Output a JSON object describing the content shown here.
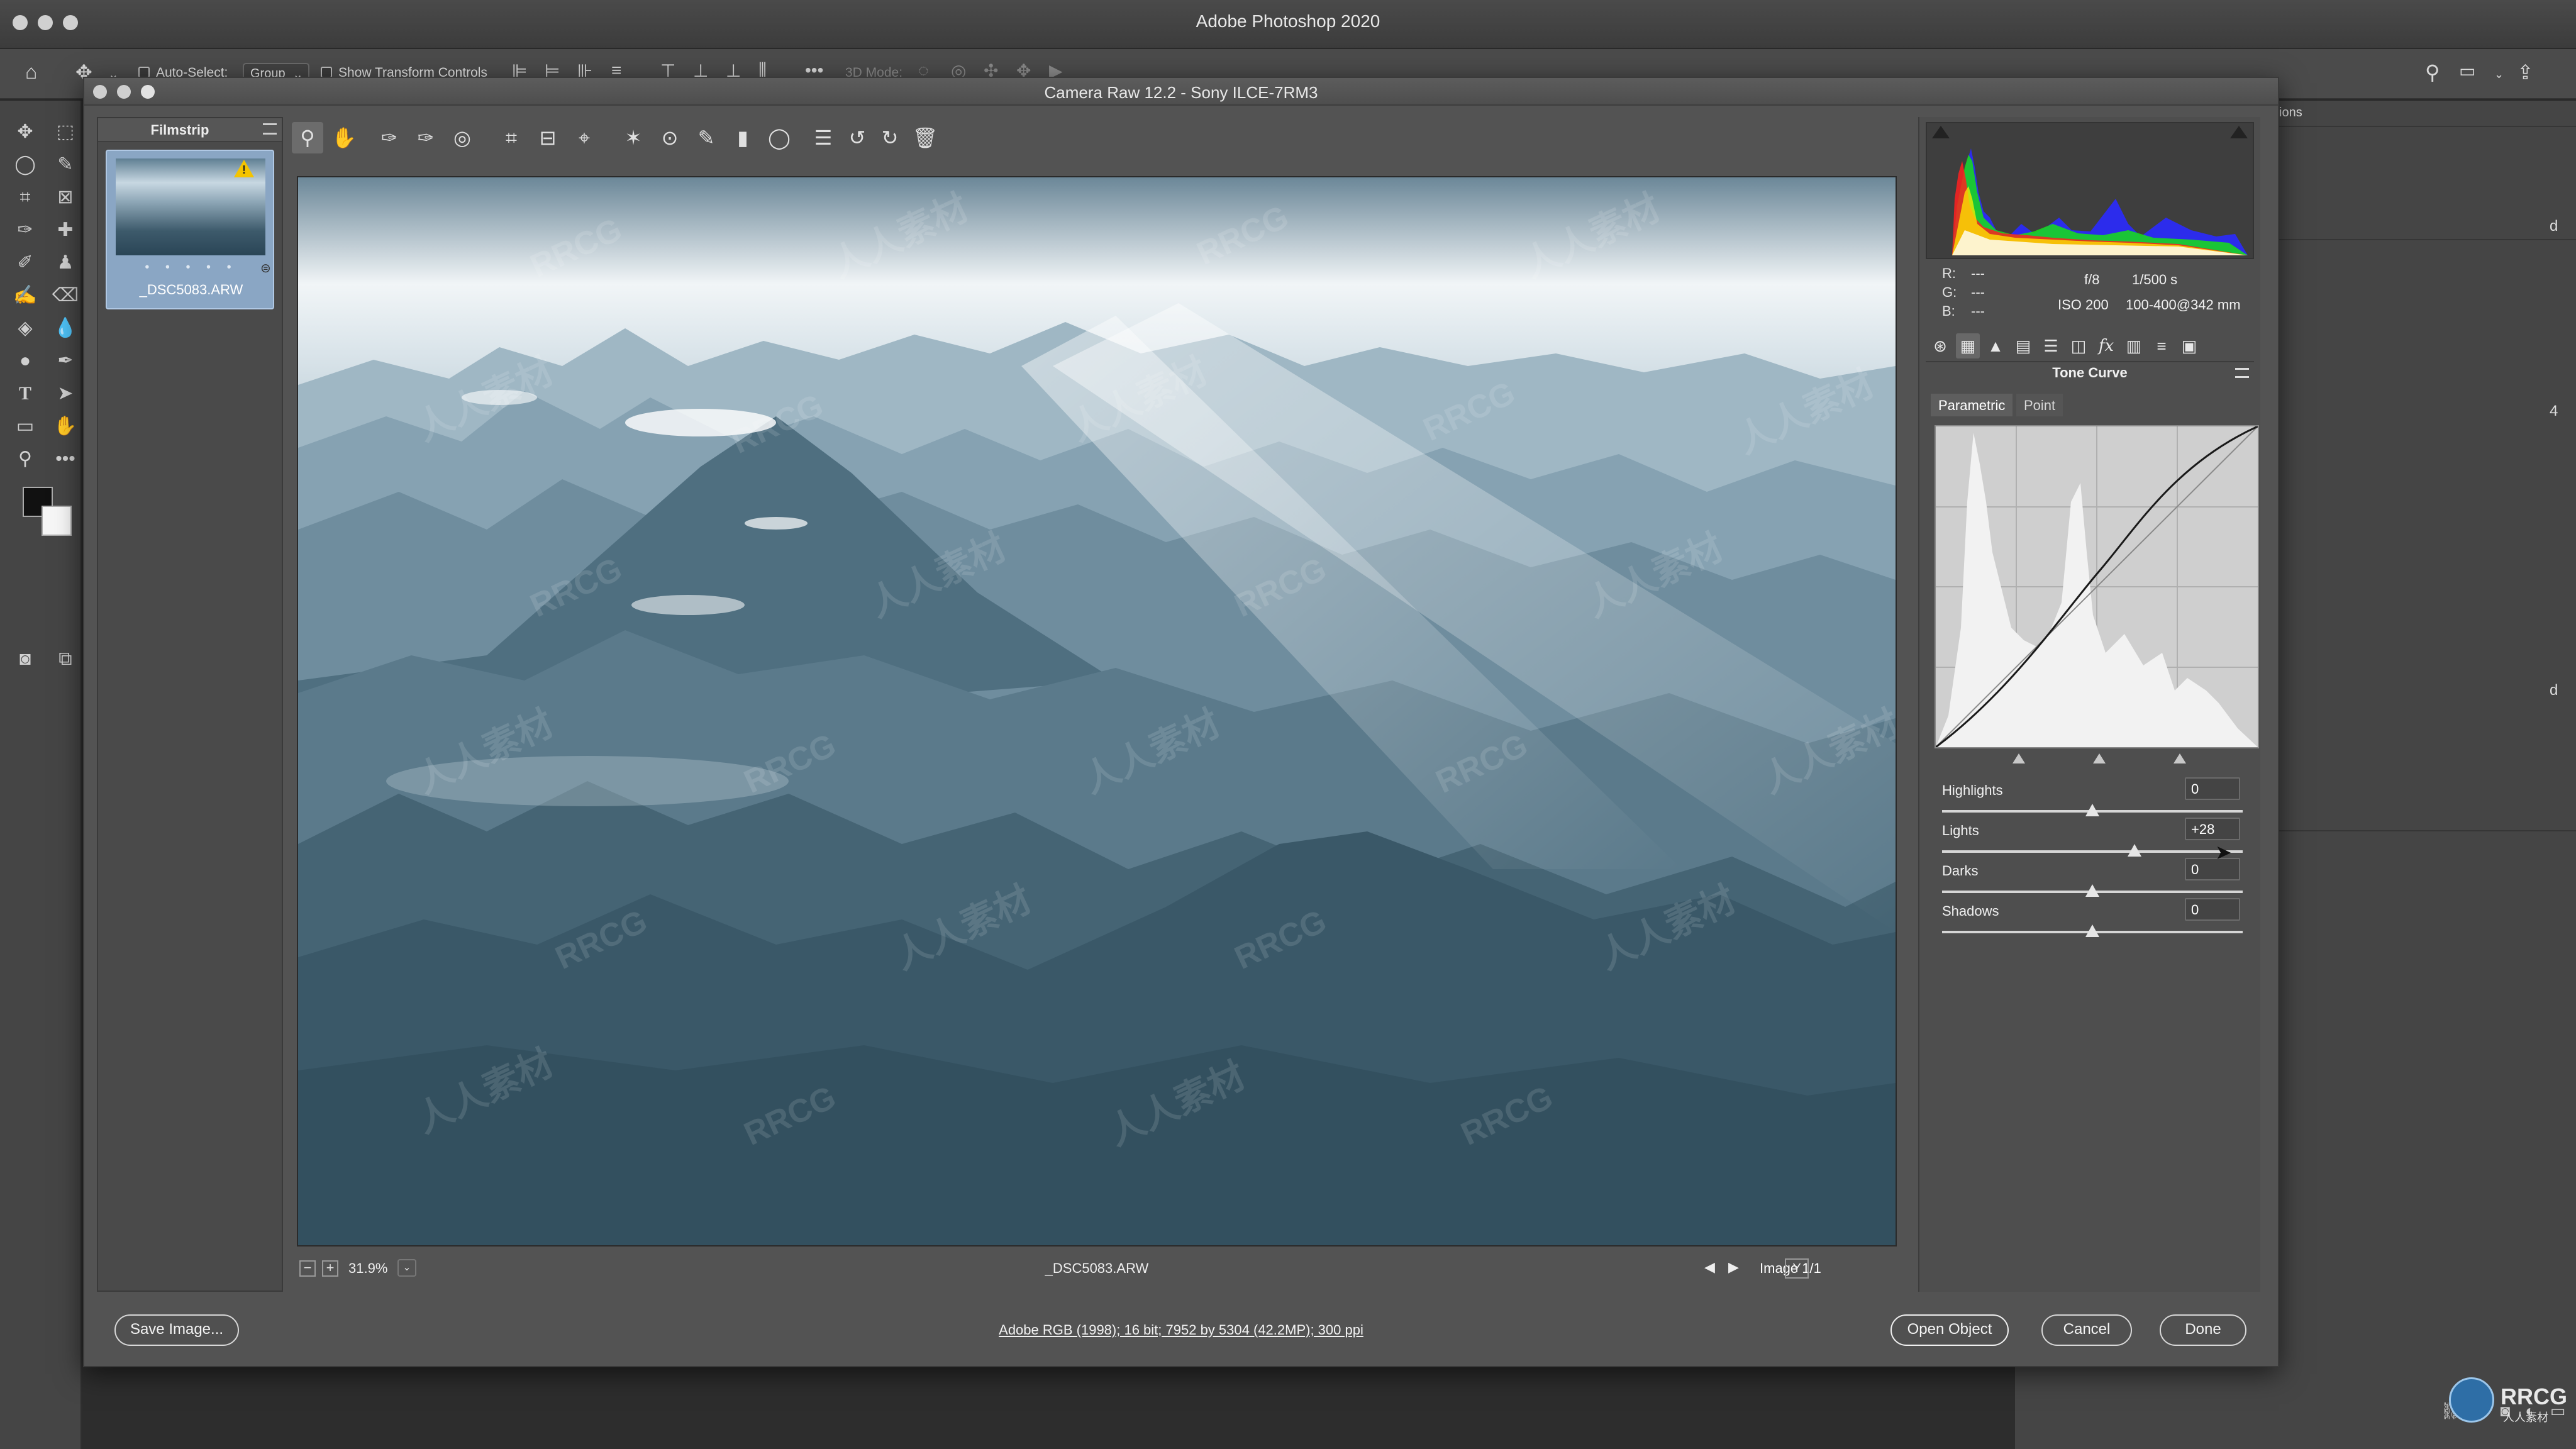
{
  "app": {
    "title": "Adobe Photoshop 2020"
  },
  "options_bar": {
    "auto_select_label": "Auto-Select:",
    "auto_select_value": "Group",
    "show_transform_label": "Show Transform Controls",
    "three_d_mode_label": "3D Mode:"
  },
  "ps_right_panel": {
    "fragment_text": "ions",
    "side_a": "d",
    "side_b": "4",
    "side_c": "d"
  },
  "dialog": {
    "title": "Camera Raw 12.2  -  Sony ILCE-7RM3",
    "filmstrip": {
      "title": "Filmstrip",
      "stars": "• • • • •",
      "file_name": "_DSC5083.ARW"
    },
    "status": {
      "zoom_minus": "−",
      "zoom_plus": "+",
      "zoom": "31.9%",
      "file_name": "_DSC5083.ARW",
      "image_count": "Image 1/1",
      "prev": "◀",
      "next": "▶"
    },
    "histogram": {
      "r_label": "R:",
      "g_label": "G:",
      "b_label": "B:",
      "r_value": "---",
      "g_value": "---",
      "b_value": "---",
      "aperture": "f/8",
      "shutter": "1/500 s",
      "iso": "ISO 200",
      "lens": "100-400@342 mm"
    },
    "panel": {
      "title": "Tone Curve",
      "subtabs": [
        "Parametric",
        "Point"
      ],
      "sliders": [
        {
          "label": "Highlights",
          "value": "0",
          "position": 0.5
        },
        {
          "label": "Lights",
          "value": "+28",
          "position": 0.64
        },
        {
          "label": "Darks",
          "value": "0",
          "position": 0.5
        },
        {
          "label": "Shadows",
          "value": "0",
          "position": 0.5
        }
      ]
    },
    "workflow": "Adobe RGB (1998); 16 bit; 7952 by 5304 (42.2MP); 300 ppi",
    "buttons": {
      "save": "Save Image...",
      "open": "Open Object",
      "cancel": "Cancel",
      "done": "Done"
    }
  },
  "watermark": {
    "latin": "RRCG",
    "cjk": "人人素材"
  },
  "logo": {
    "text": "RRCG",
    "sub": "人人素材"
  }
}
